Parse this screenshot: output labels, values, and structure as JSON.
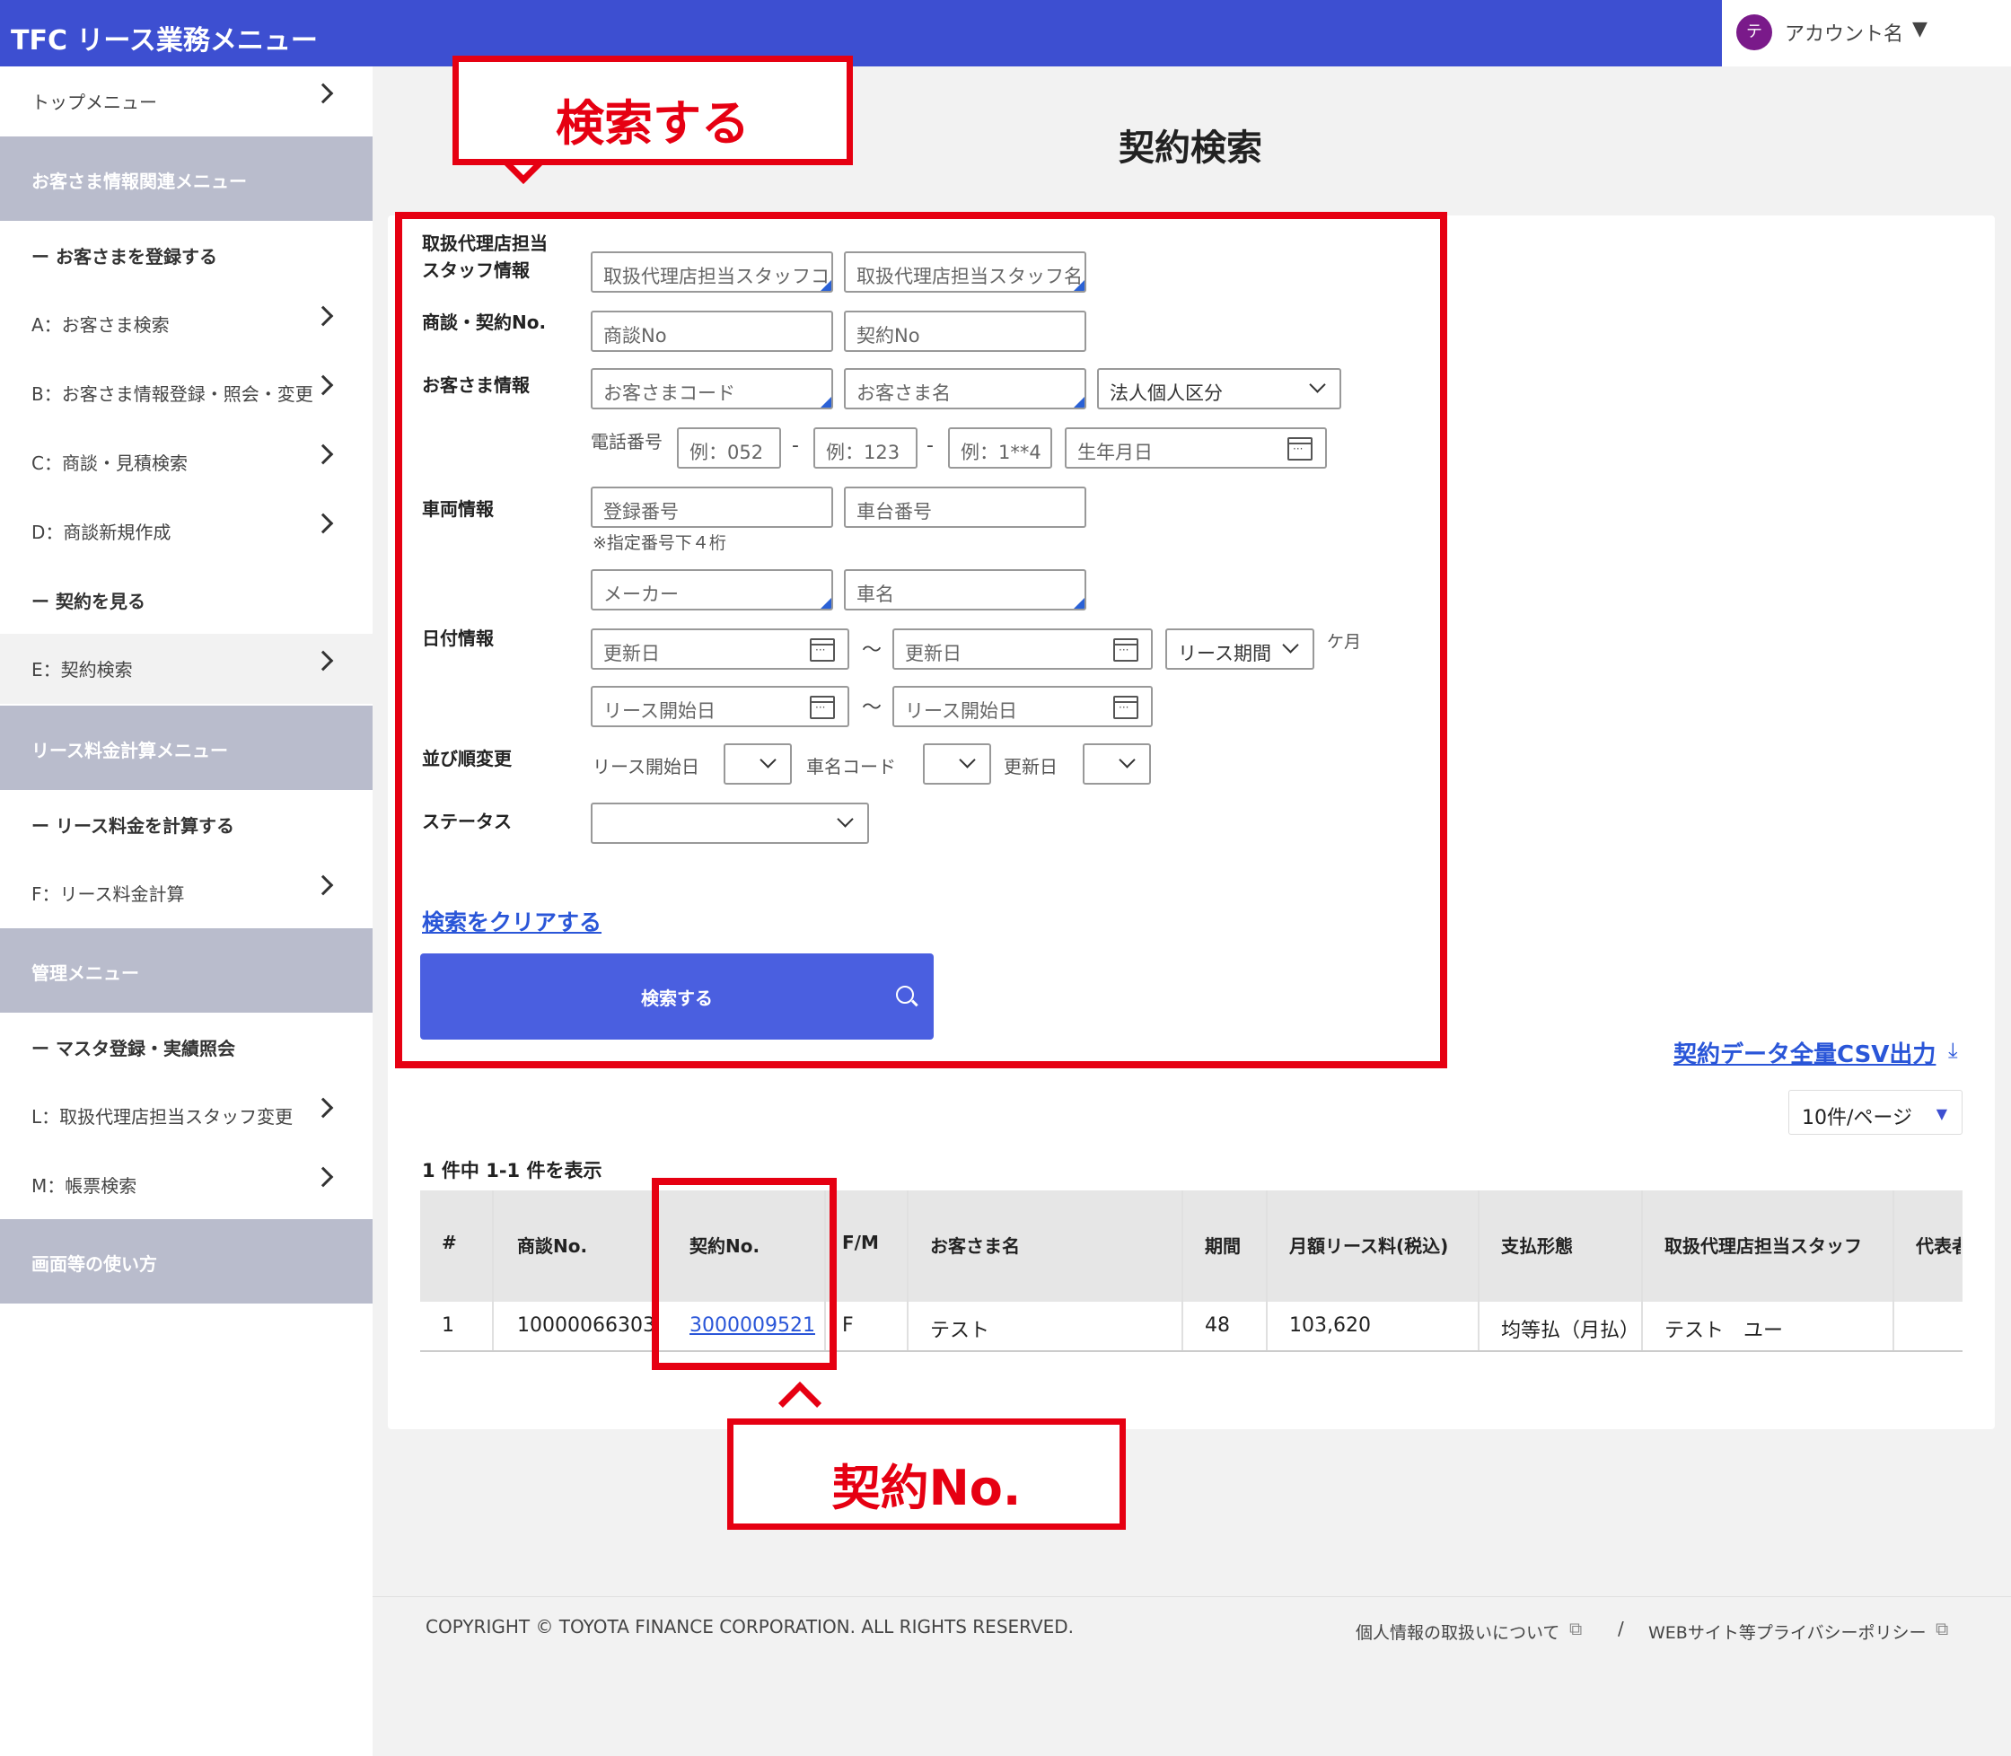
{
  "header": {
    "app_title": "TFC リース業務メニュー",
    "avatar_initial": "テ",
    "account_name": "アカウント名",
    "account_caret": "▼"
  },
  "sidebar": {
    "top_menu": "トップメニュー",
    "section1": "お客さま情報関連メニュー",
    "sub1": "ー お客さまを登録する",
    "item_a": "A：お客さま検索",
    "item_b": "B：お客さま情報登録・照会・変更",
    "item_c": "C：商談・見積検索",
    "item_d": "D：商談新規作成",
    "sub2": "ー 契約を見る",
    "item_e": "E：契約検索",
    "section2": "リース料金計算メニュー",
    "sub3": "ー リース料金を計算する",
    "item_f": "F：リース料金計算",
    "section3": "管理メニュー",
    "sub4": "ー マスタ登録・実績照会",
    "item_l": "L：取扱代理店担当スタッフ変更",
    "item_m": "M：帳票検索",
    "section4": "画面等の使い方"
  },
  "page_title": "契約検索",
  "form": {
    "staff_label_1": "取扱代理店担当",
    "staff_label_2": "スタッフ情報",
    "staff_code_ph": "取扱代理店担当スタッフコ",
    "staff_name_ph": "取扱代理店担当スタッフ名",
    "deal_label": "商談・契約No.",
    "deal_no_ph": "商談No",
    "contract_no_ph": "契約No",
    "customer_label": "お客さま情報",
    "customer_code_ph": "お客さまコード",
    "customer_name_ph": "お客さま名",
    "corp_type": "法人個人区分",
    "phone_label": "電話番号",
    "phone1_ph": "例：052",
    "phone2_ph": "例：123",
    "phone3_ph": "例：1**4",
    "phone_sep": "-",
    "birth_ph": "生年月日",
    "vehicle_label": "車両情報",
    "reg_no_ph": "登録番号",
    "chassis_ph": "車台番号",
    "reg_note": "※指定番号下４桁",
    "maker_ph": "メーカー",
    "car_name_ph": "車名",
    "date_label": "日付情報",
    "update_from_ph": "更新日",
    "update_to_ph": "更新日",
    "range_sep": "〜",
    "lease_period": "リース期間",
    "months_unit": "ケ月",
    "start_from_ph": "リース開始日",
    "start_to_ph": "リース開始日",
    "sort_label": "並び順変更",
    "sort_start": "リース開始日",
    "sort_carcode": "車名コード",
    "sort_update": "更新日",
    "status_label": "ステータス",
    "clear_link": "検索をクリアする",
    "search_button": "検索する"
  },
  "results": {
    "csv_link": "契約データ全量CSV出力",
    "csv_icon": "⤓",
    "page_size": "10件/ページ",
    "page_size_caret": "▼",
    "count_text": "1 件中  1-1  件を表示",
    "columns": [
      "#",
      "商談No.",
      "契約No.",
      "F/M",
      "お客さま名",
      "期間",
      "月額リース料(税込)",
      "支払形態",
      "取扱代理店担当スタッフ",
      "代表者"
    ],
    "row": [
      "1",
      "10000066303",
      "3000009521",
      "F",
      "テスト",
      "48",
      "103,620",
      "均等払（月払）",
      "テスト　ユー",
      ""
    ]
  },
  "annotations": {
    "callout_search": "検索する",
    "callout_contract": "契約No.",
    "color": "#e60012"
  },
  "footer": {
    "copyright": "COPYRIGHT © TOYOTA FINANCE CORPORATION. ALL RIGHTS RESERVED.",
    "privacy1": "個人情報の取扱いについて",
    "separator": "/",
    "privacy2": "WEBサイト等プライバシーポリシー",
    "ext_icon": "⧉"
  },
  "colors": {
    "header_bg": "#3d4fd1",
    "button_bg": "#4a5fe0",
    "link": "#2a56d8",
    "sidebar_section": "#b9bccc"
  }
}
